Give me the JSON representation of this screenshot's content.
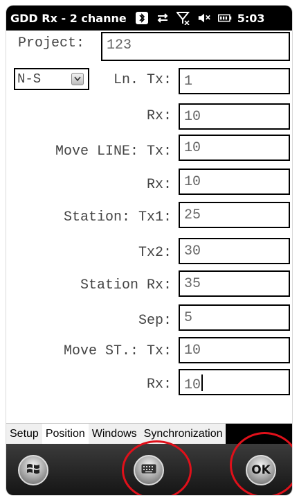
{
  "status_bar": {
    "title": "GDD Rx - 2 channe",
    "time": "5:03",
    "icons": [
      "bluetooth-icon",
      "data-transfer-icon",
      "no-signal-icon",
      "volume-muted-icon",
      "battery-icon"
    ]
  },
  "project": {
    "label": "Project:",
    "value": "123"
  },
  "direction_select": {
    "value": "N-S"
  },
  "fields": {
    "line_tx": {
      "label": "Ln. Tx:",
      "value": "1"
    },
    "line_rx": {
      "label": "Rx:",
      "value": "10"
    },
    "move_line_tx": {
      "label": "Move LINE: Tx:",
      "value": "10"
    },
    "move_line_rx": {
      "label": "Rx:",
      "value": "10"
    },
    "station_tx1": {
      "label": "Station: Tx1:",
      "value": "25"
    },
    "station_tx2": {
      "label": "Tx2:",
      "value": "30"
    },
    "station_rx": {
      "label": "Station Rx:",
      "value": "35"
    },
    "sep": {
      "label": "Sep:",
      "value": "5"
    },
    "move_st_tx": {
      "label": "Move ST.: Tx:",
      "value": "10"
    },
    "move_st_rx": {
      "label": "Rx:",
      "value": "10"
    }
  },
  "tabs": [
    {
      "label": "Setup",
      "active": false
    },
    {
      "label": "Position",
      "active": true
    },
    {
      "label": "Windows",
      "active": false
    },
    {
      "label": "Synchronization",
      "active": false
    }
  ],
  "softkeys": {
    "ok_label": "OK",
    "start_icon": "windows-start-icon",
    "keyboard_icon": "keyboard-icon"
  },
  "colors": {
    "annotation": "#e0101a",
    "statusbar": "#000000"
  }
}
